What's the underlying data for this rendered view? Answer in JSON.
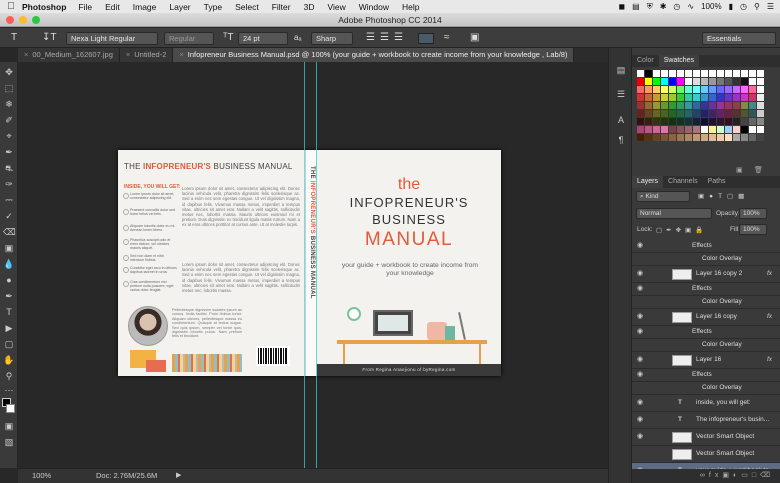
{
  "menubar": {
    "app": "Photoshop",
    "items": [
      "File",
      "Edit",
      "Image",
      "Layer",
      "Type",
      "Select",
      "Filter",
      "3D",
      "View",
      "Window",
      "Help"
    ],
    "battery": "100%"
  },
  "window": {
    "title": "Adobe Photoshop CC 2014"
  },
  "options": {
    "font_family": "Nexa Light Regular",
    "font_style": "Regular",
    "font_size": "24 pt",
    "aa_label": "aₐ",
    "antialias": "Sharp",
    "workspace": "Essentials"
  },
  "tabs": [
    {
      "label": "00_Medium_162607.jpg"
    },
    {
      "label": "Untitled-2"
    },
    {
      "label": "Infopreneur Business Manual.psd @ 100% (your guide + workbook to create income from your knowledge , Lab/8)"
    }
  ],
  "status": {
    "zoom": "100%",
    "doc": "Doc: 2.76M/25.6M"
  },
  "cover": {
    "back_title_a": "THE ",
    "back_title_b": "INFOPRENEUR'S",
    "back_title_c": " BUSINESS MANUAL",
    "inside": "INSIDE, YOU WILL GET:",
    "bullets": [
      "Lorem ipsum dolor sit amet, consectetur adipiscing elit.",
      "Praesent convallis dolor sed tortor tellus vel felis.",
      "Aliquam lobortis dolor eu mi. Aenean lorem libero.",
      "Phasellus suscipit odio et enim dictum, vel ultricies mauris aliquet.",
      "Sed non diam et nibh interdum finibus.",
      "Curabitur eget arcu in ultrices dapibus laoreet in urna.",
      "Cras condimentum nisi pretium nulla posuere, eget varius dolor feugiat."
    ],
    "lorem1": "Lorem ipsum dolor sit amet, consectetur adipiscing elit. Donec lacinia vehicula velit, pharetra dignissim felis scelerisque ac. Sed a enim nec sem egestas congue. Ut vel dignissim magna, id dapibus felis. Vivamus massa metus, imperdiet a tempus vitae, ultricies sit amet erat. Nullam a velit sagittis, sollicitudin metus nec, lobortis massa. Mauris ultrices euismod mi et pretium. Duis dignissim ex tincidunt ligula mattis rutrum. Nam a ex at eros ultrices porttitor at cursus ante. Ut at molestie turpis.",
    "lorem2": "Lorem ipsum dolor sit amet, consectetur adipiscing elit. Donec lacinia vehicula velit, pharetra dignissim felis scelerisque ac. Sed a enim nec sem egestas congue. Ut vel dignissim magna, id dapibus felis. Vivamus massa metus, imperdiet a tempus vitae, ultricies sit amet erat. Nullam a velit sagittis, sollicitudin metus nec, lobortis massa.",
    "lorem3": "Pellentesque dignissim sodales ipsum ac cursus. Nulla facilisi. Proin finibus tortor. Aliquam ultrices, pellentesque massa eu condimentum. Quisque at lectus augue. Sed quis ipsum, semper vel tortor quis, dignissim lobortis purus. Nam pretium felis et tincidunt.",
    "spine_a": "THE ",
    "spine_b": "INFOPRENEUR'S",
    "spine_c": " BUSINESS MANUAL",
    "front_the": "the",
    "front_l1": "INFOPRENEUR'S",
    "front_l2": "BUSINESS",
    "front_l3": "MANUAL",
    "front_sub": "your guide + workbook to create income from your knowledge",
    "author": "From Regina Anaejionu of byRegina.com"
  },
  "panels": {
    "color_tab": "Color",
    "swatches_tab": "Swatches",
    "layers_tab": "Layers",
    "channels_tab": "Channels",
    "paths_tab": "Paths",
    "kind": "⌕ Kind",
    "blend_mode": "Normal",
    "opacity_label": "Opacity:",
    "opacity": "100%",
    "lock_label": "Lock:",
    "fill_label": "Fill:",
    "fill": "100%",
    "layers": [
      {
        "name": "Effects",
        "type": "sub"
      },
      {
        "name": "Color Overlay",
        "type": "sub2"
      },
      {
        "name": "Layer 16 copy 2",
        "type": "layer",
        "fx": "fx"
      },
      {
        "name": "Effects",
        "type": "sub"
      },
      {
        "name": "Color Overlay",
        "type": "sub2"
      },
      {
        "name": "Layer 16 copy",
        "type": "layer",
        "fx": "fx"
      },
      {
        "name": "Effects",
        "type": "sub"
      },
      {
        "name": "Color Overlay",
        "type": "sub2"
      },
      {
        "name": "Layer 16",
        "type": "layer",
        "fx": "fx"
      },
      {
        "name": "Effects",
        "type": "sub"
      },
      {
        "name": "Color Overlay",
        "type": "sub2"
      },
      {
        "name": "inside, you will get:",
        "type": "text"
      },
      {
        "name": "The infopreneur's busin...",
        "type": "text"
      },
      {
        "name": "Vector Smart Object",
        "type": "smart"
      },
      {
        "name": "Vector Smart Object",
        "type": "smart"
      },
      {
        "name": "your guide + workbook to ...",
        "type": "text",
        "selected": true
      }
    ]
  },
  "colors": {
    "accent": "#e35a3a",
    "selection": "#5d6c84",
    "guide": "#3dd6d6"
  }
}
